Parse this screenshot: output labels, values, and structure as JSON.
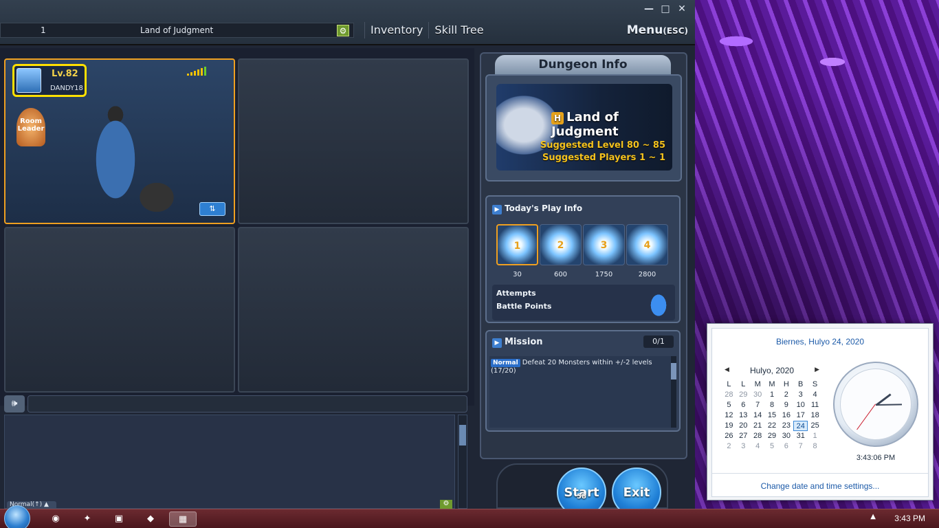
{
  "game": {
    "room_number": "1",
    "room_name": "Land of Judgment",
    "nav": [
      "Inventory",
      "Skill Tree"
    ],
    "menu_label": "Menu",
    "menu_shortcut": "(ESC)",
    "window_buttons": [
      "—",
      "□",
      "✕"
    ]
  },
  "player": {
    "level": "Lv.82",
    "name": "DANDY18",
    "badge": "Room Leader"
  },
  "dungeon": {
    "header": "Dungeon Info",
    "title": "Land of Judgment",
    "suggested_level_label": "Suggested Level",
    "suggested_level_value": "80 ~ 85",
    "suggested_players_label": "Suggested Players",
    "suggested_players_value": "1 ~ 1"
  },
  "play_info": {
    "header": "Today's Play Info",
    "tiers": [
      {
        "num": "1",
        "value": "30"
      },
      {
        "num": "2",
        "value": "600"
      },
      {
        "num": "3",
        "value": "1750"
      },
      {
        "num": "4",
        "value": "2800"
      }
    ],
    "attempts_label": "Attempts",
    "battle_points_label": "Battle Points"
  },
  "mission": {
    "header": "Mission",
    "count": "0/1",
    "tag": "Normal",
    "text": "Defeat 20 Monsters within +/-2 levels (17/20)"
  },
  "buttons": {
    "start": "Start",
    "exit": "Exit",
    "start_sub": "58"
  },
  "chat": {
    "tab": "Normal(↑) ▲"
  },
  "calendar": {
    "date_title": "Biernes, Hulyo 24, 2020",
    "month": "Hulyo, 2020",
    "weekdays": [
      "L",
      "L",
      "M",
      "M",
      "H",
      "B",
      "S"
    ],
    "weeks": [
      [
        "28",
        "29",
        "30",
        "1",
        "2",
        "3",
        "4"
      ],
      [
        "5",
        "6",
        "7",
        "8",
        "9",
        "10",
        "11"
      ],
      [
        "12",
        "13",
        "14",
        "15",
        "16",
        "17",
        "18"
      ],
      [
        "19",
        "20",
        "21",
        "22",
        "23",
        "24",
        "25"
      ],
      [
        "26",
        "27",
        "28",
        "29",
        "30",
        "31",
        "1"
      ],
      [
        "2",
        "3",
        "4",
        "5",
        "6",
        "7",
        "8"
      ]
    ],
    "selected": "24",
    "time": "3:43:06 PM",
    "link": "Change date and time settings..."
  },
  "taskbar": {
    "clock": "3:43 PM"
  },
  "colors": {
    "accent": "#f0a020",
    "highlight": "#ffe000",
    "link": "#1c5aa8"
  }
}
